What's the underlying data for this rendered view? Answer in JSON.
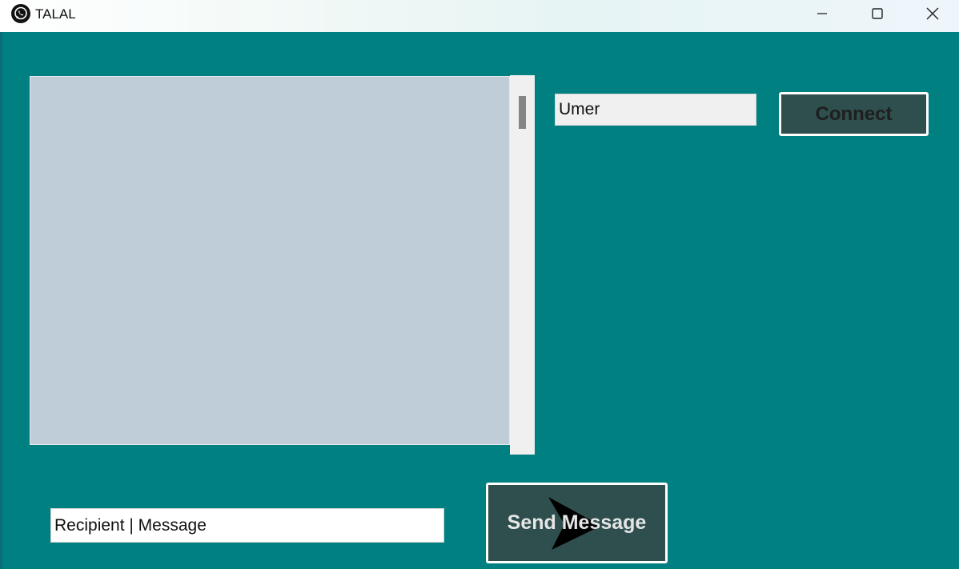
{
  "window": {
    "title": "TALAL",
    "app_icon": "whatsapp-icon",
    "controls": {
      "minimize_icon": "minimize-icon",
      "maximize_icon": "maximize-icon",
      "close_icon": "close-icon"
    }
  },
  "colors": {
    "background": "#008080",
    "chat_log_background": "#bfcdd9",
    "button_background": "#2f4f4f",
    "button_border": "#ffffff",
    "connect_text": "#1e1e1e",
    "send_text": "#e6e6e6"
  },
  "connection": {
    "username_value": "Umer",
    "connect_label": "Connect"
  },
  "compose": {
    "message_value": "Recipient | Message",
    "send_label": "Send Message",
    "send_icon": "arrow-right-icon"
  }
}
